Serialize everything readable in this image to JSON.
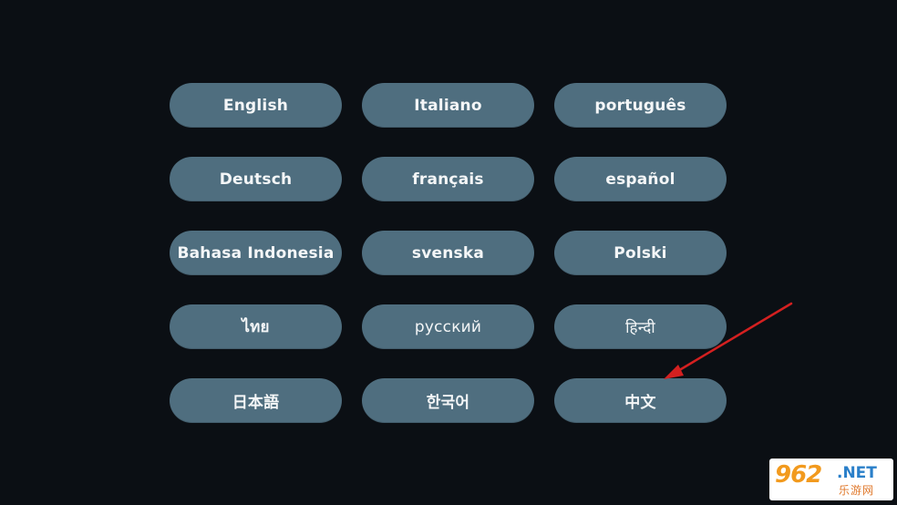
{
  "languages": [
    {
      "label": "English"
    },
    {
      "label": "Italiano"
    },
    {
      "label": "português"
    },
    {
      "label": "Deutsch"
    },
    {
      "label": "français"
    },
    {
      "label": "español"
    },
    {
      "label": "Bahasa Indonesia"
    },
    {
      "label": "svenska"
    },
    {
      "label": "Polski"
    },
    {
      "label": "ไทย"
    },
    {
      "label": "русский"
    },
    {
      "label": "हिन्दी"
    },
    {
      "label": "日本語"
    },
    {
      "label": "한국어"
    },
    {
      "label": "中文"
    }
  ],
  "annotation": {
    "arrow_color": "#d42020",
    "target_language": "中文"
  },
  "watermark": {
    "logo": "962",
    "suffix": ".NET",
    "site_name": "乐游网"
  },
  "colors": {
    "background": "#0b0f14",
    "button": "#4f6e7f",
    "button_text": "#f4f6f7"
  }
}
